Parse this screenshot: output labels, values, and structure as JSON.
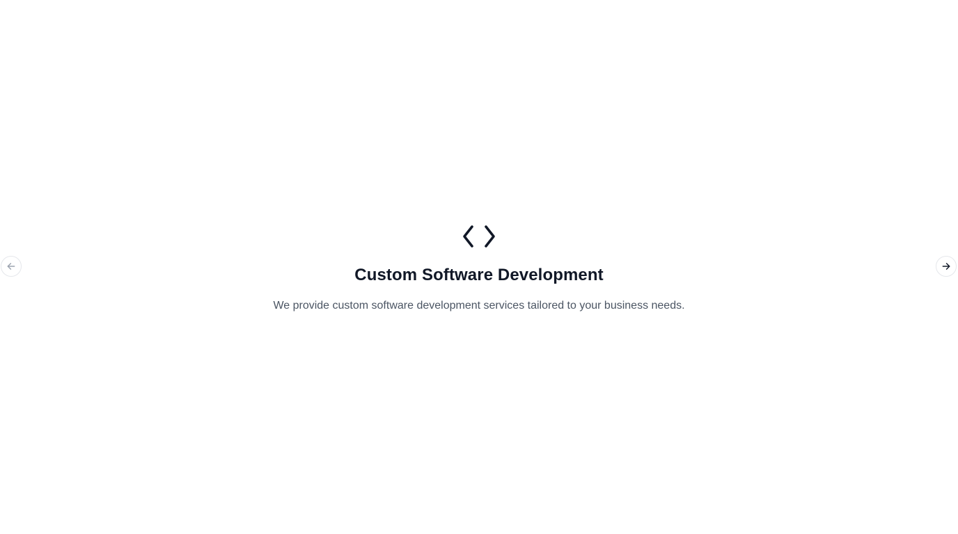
{
  "carousel": {
    "slide": {
      "icon": "code-brackets-icon",
      "title": "Custom Software Development",
      "description": "We provide custom software development services tailored to your business needs."
    },
    "prev_button": {
      "icon": "arrow-left-icon",
      "disabled": true
    },
    "next_button": {
      "icon": "arrow-right-icon",
      "disabled": false
    },
    "colors": {
      "title": "#111827",
      "description": "#4b5563",
      "icon": "#111827",
      "nav_active": "#111827",
      "nav_disabled": "#9ca3af"
    }
  }
}
